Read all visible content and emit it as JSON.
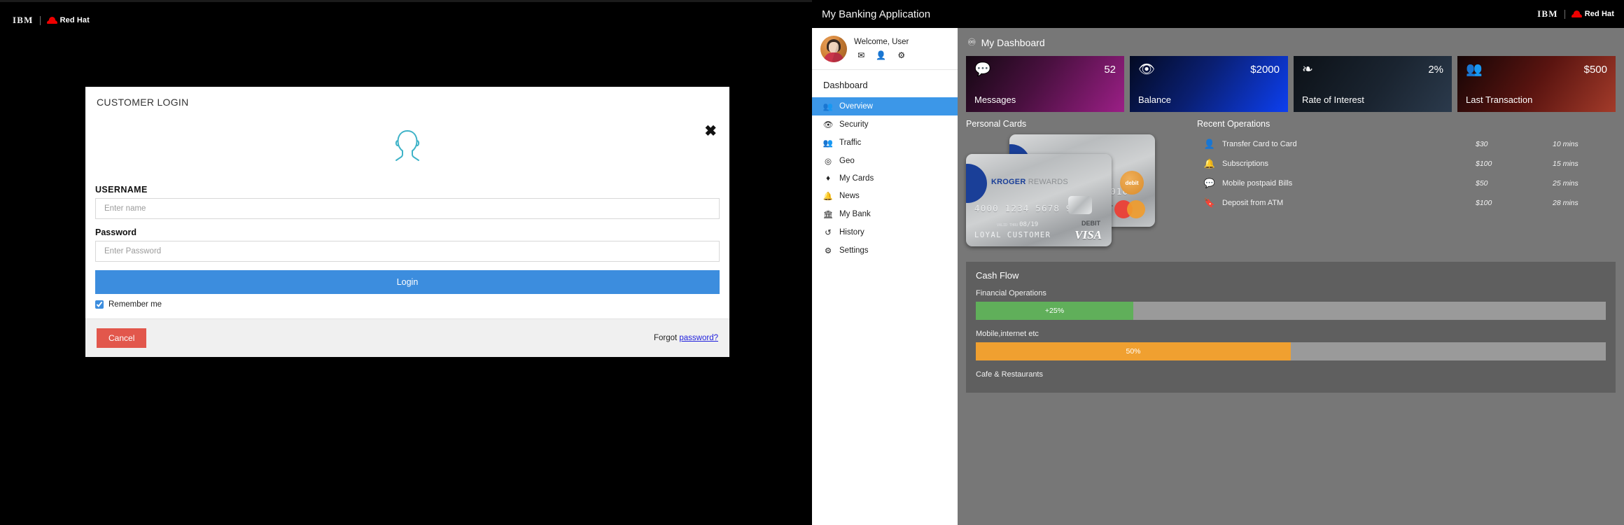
{
  "left": {
    "brand": {
      "ibm": "IBM",
      "redhat": "Red Hat"
    },
    "login": {
      "title": "CUSTOMER LOGIN",
      "close_icon": "close-icon",
      "username_label": "USERNAME",
      "username_placeholder": "Enter name",
      "username_value": "",
      "password_label": "Password",
      "password_placeholder": "Enter Password",
      "password_value": "",
      "login_button": "Login",
      "remember_label": "Remember me",
      "remember_checked": true,
      "cancel_button": "Cancel",
      "forgot_prefix": "Forgot ",
      "forgot_link": "password?"
    }
  },
  "app": {
    "header": {
      "title": "My Banking Application",
      "ibm": "IBM",
      "redhat": "Red Hat"
    },
    "profile": {
      "welcome": "Welcome, User",
      "icons": [
        "envelope-icon",
        "user-icon",
        "gear-icon"
      ]
    },
    "sidebar": {
      "heading": "Dashboard",
      "items": [
        {
          "label": "Overview",
          "icon": "users-icon",
          "active": true
        },
        {
          "label": "Security",
          "icon": "eye-icon",
          "active": false
        },
        {
          "label": "Traffic",
          "icon": "users-icon",
          "active": false
        },
        {
          "label": "Geo",
          "icon": "bullseye-icon",
          "active": false
        },
        {
          "label": "My Cards",
          "icon": "gem-icon",
          "active": false
        },
        {
          "label": "News",
          "icon": "bell-icon",
          "active": false
        },
        {
          "label": "My Bank",
          "icon": "bank-icon",
          "active": false
        },
        {
          "label": "History",
          "icon": "history-icon",
          "active": false
        },
        {
          "label": "Settings",
          "icon": "gear-icon",
          "active": false
        }
      ]
    },
    "dashboard": {
      "title": "My Dashboard",
      "title_icon": "tachometer-icon",
      "stats": [
        {
          "label": "Messages",
          "value": "52",
          "icon": "comment-icon",
          "theme": "c-messages"
        },
        {
          "label": "Balance",
          "value": "$2000",
          "icon": "eye-icon",
          "theme": "c-balance"
        },
        {
          "label": "Rate of Interest",
          "value": "2%",
          "icon": "share-icon",
          "theme": "c-rate"
        },
        {
          "label": "Last Transaction",
          "value": "$500",
          "icon": "users-icon",
          "theme": "c-last"
        }
      ],
      "personal_cards": {
        "title": "Personal Cards",
        "front": {
          "brand": "KROGER",
          "brand_sub": "REWARDS",
          "number": "4000 1234 5678 9010",
          "valid_prefix": "VALID THRU",
          "valid": "08/19",
          "holder": "LOYAL CUSTOMER",
          "debit": "DEBIT",
          "network": "VISA"
        },
        "back": {
          "brand": "KROGER",
          "brand_sub": "REWARDS",
          "number": "9 9010",
          "badge": "debit",
          "debit": "DEBIT",
          "network": "mastercard"
        }
      },
      "recent_operations": {
        "title": "Recent Operations",
        "rows": [
          {
            "icon": "user-icon",
            "icon_color": "#3c97e8",
            "name": "Transfer Card to Card",
            "amount": "$30",
            "time": "10 mins"
          },
          {
            "icon": "bell-icon",
            "icon_color": "#e8453c",
            "name": "Subscriptions",
            "amount": "$100",
            "time": "15 mins"
          },
          {
            "icon": "comment-icon",
            "icon_color": "#e8453c",
            "name": "Mobile postpaid Bills",
            "amount": "$50",
            "time": "25 mins"
          },
          {
            "icon": "bookmark-icon",
            "icon_color": "#3c97e8",
            "name": "Deposit from ATM",
            "amount": "$100",
            "time": "28 mins"
          }
        ]
      },
      "cash_flow": {
        "title": "Cash Flow",
        "bars": [
          {
            "label": "Financial Operations",
            "text": "+25%",
            "percent": 25,
            "color": "#60af5a"
          },
          {
            "label": "Mobile,internet etc",
            "text": "50%",
            "percent": 50,
            "color": "#f0a030"
          },
          {
            "label": "Cafe & Restaurants",
            "text": "",
            "percent": 0,
            "color": "#3c97e8"
          }
        ]
      }
    }
  }
}
